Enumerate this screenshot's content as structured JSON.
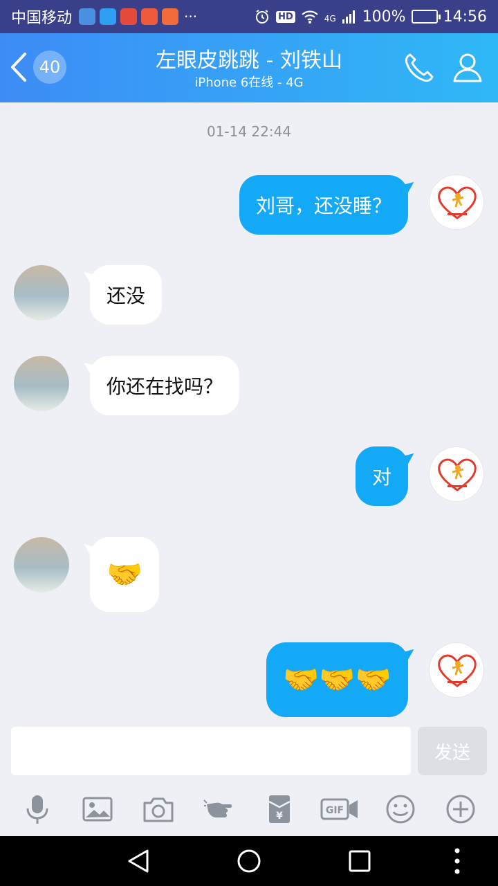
{
  "status_bar": {
    "carrier": "中国移动",
    "more": "···",
    "hd": "HD",
    "network": "4G",
    "battery": "100%",
    "time": "14:56",
    "app_icon_colors": [
      "#4a8fe0",
      "#2e9ff2",
      "#e64a3b",
      "#f05a3c",
      "#f26b3a"
    ]
  },
  "header": {
    "unread_count": "40",
    "title": "左眼皮跳跳 - 刘铁山",
    "subtitle": "iPhone 6在线 - 4G"
  },
  "chat": {
    "timestamp": "01-14 22:44",
    "messages": [
      {
        "from": "me",
        "text": "刘哥，还没睡？"
      },
      {
        "from": "friend",
        "text": "还没"
      },
      {
        "from": "friend",
        "text": "你还在找吗？"
      },
      {
        "from": "me",
        "text": "对"
      },
      {
        "from": "friend",
        "text": "🤝"
      },
      {
        "from": "me",
        "text": "🤝🤝🤝"
      }
    ]
  },
  "input": {
    "value": "",
    "send_label": "发送"
  },
  "toolbar": {
    "icons": [
      "mic-icon",
      "image-icon",
      "camera-icon",
      "poke-icon",
      "red-packet-icon",
      "gif-icon",
      "emoji-icon",
      "plus-icon"
    ]
  },
  "colors": {
    "header_start": "#3d8cf5",
    "header_end": "#2fb8f7",
    "bubble_out": "#14a9f6",
    "bubble_in": "#ffffff",
    "background": "#eef0f5"
  }
}
